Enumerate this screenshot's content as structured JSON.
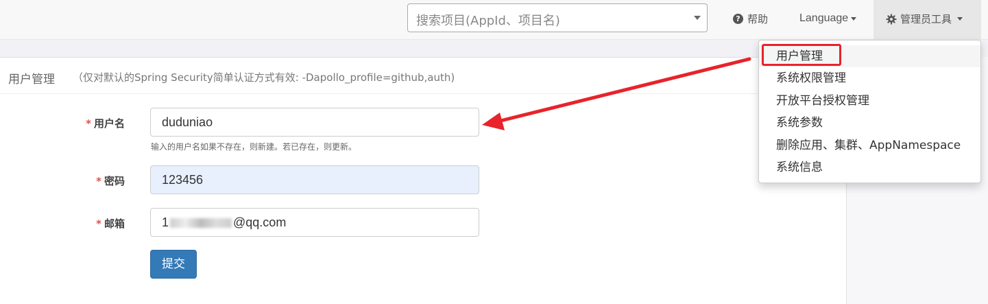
{
  "navbar": {
    "search_placeholder": "搜索项目(AppId、项目名)",
    "help_label": "帮助",
    "language_label": "Language",
    "admin_tools_label": "管理员工具"
  },
  "panel": {
    "title": "用户管理",
    "note": "（仅对默认的Spring Security简单认证方式有效: -Dapollo_profile=github,auth)"
  },
  "form": {
    "required_mark": "*",
    "username_label": "用户名",
    "username_value": "duduniao",
    "username_help": "输入的用户名如果不存在，则新建。若已存在，则更新。",
    "password_label": "密码",
    "password_value": "123456",
    "email_label": "邮箱",
    "email_prefix": "1",
    "email_suffix": "@qq.com",
    "submit_label": "提交"
  },
  "dropdown": {
    "items": [
      {
        "label": "用户管理"
      },
      {
        "label": "系统权限管理"
      },
      {
        "label": "开放平台授权管理"
      },
      {
        "label": "系统参数"
      },
      {
        "label": "删除应用、集群、AppNamespace"
      },
      {
        "label": "系统信息"
      }
    ]
  },
  "colors": {
    "accent": "#337ab7",
    "annotation": "#e8232b",
    "required": "#d9534f"
  }
}
